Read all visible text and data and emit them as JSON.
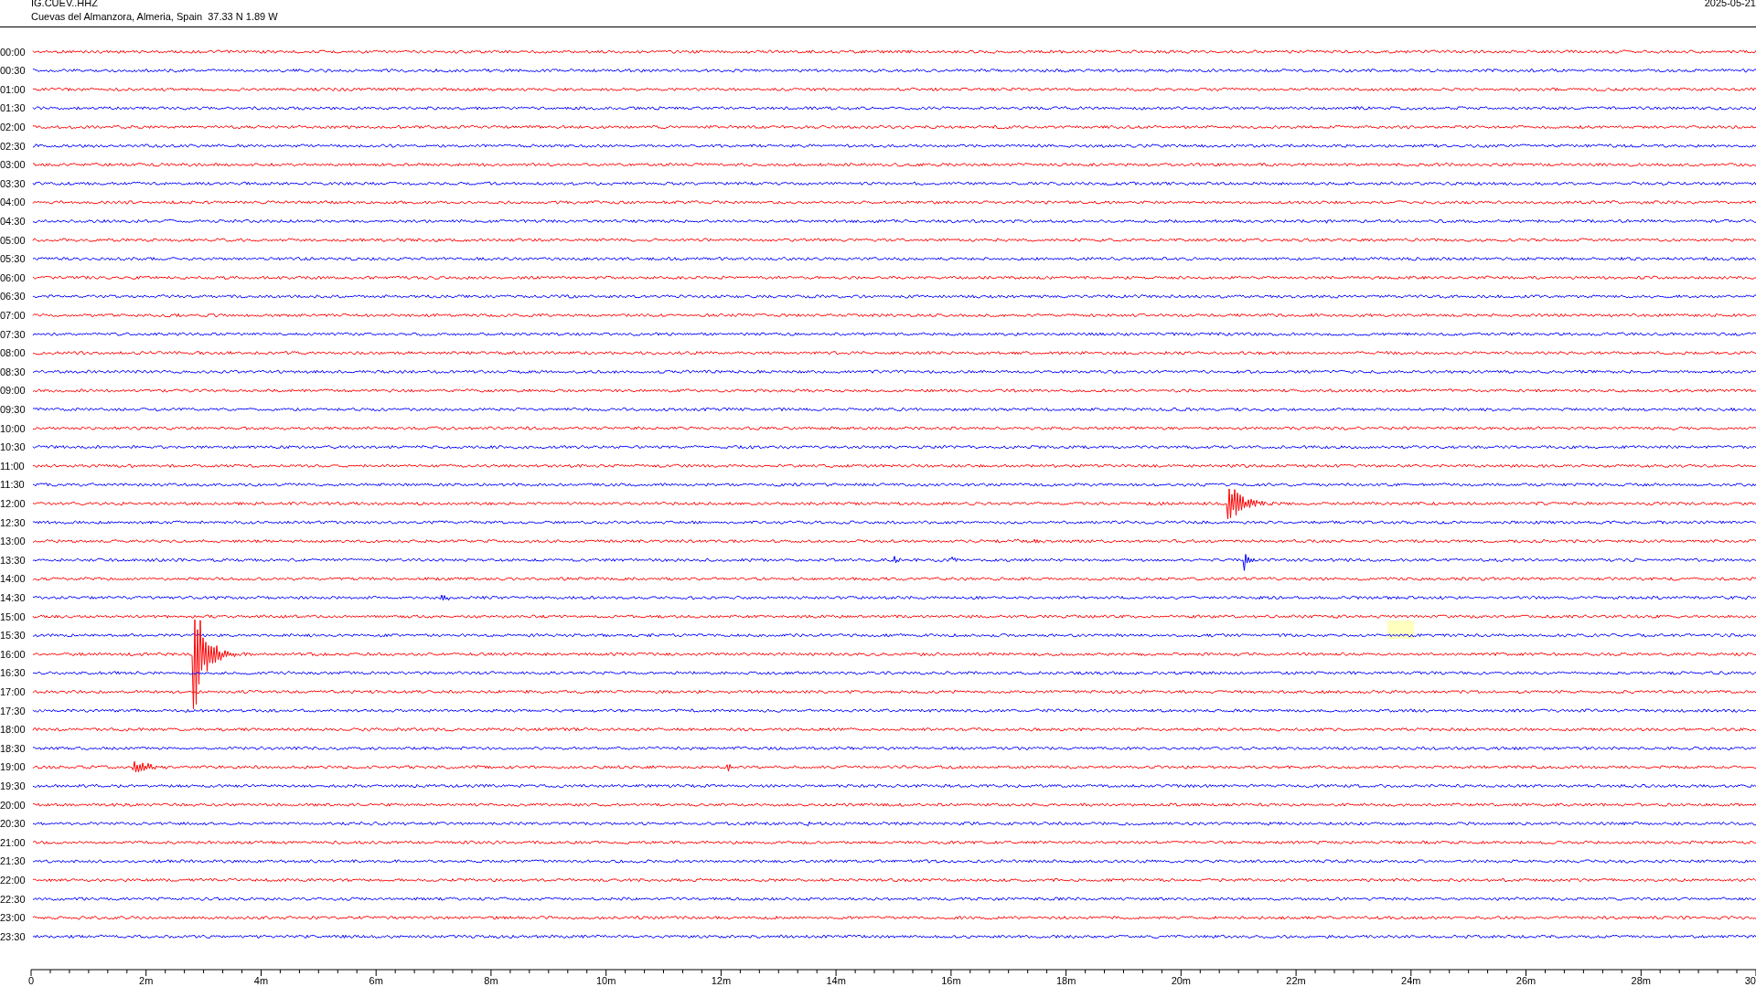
{
  "header": {
    "station": "IG.CUEV..HHZ",
    "location": "Cuevas del Almanzora, Almeria, Spain  37.33 N 1.89 W",
    "date": "2025-05-21"
  },
  "rows": [
    {
      "time": "00:00",
      "color": "#ff0000"
    },
    {
      "time": "00:30",
      "color": "#0000ff"
    },
    {
      "time": "01:00",
      "color": "#ff0000"
    },
    {
      "time": "01:30",
      "color": "#0000ff"
    },
    {
      "time": "02:00",
      "color": "#ff0000"
    },
    {
      "time": "02:30",
      "color": "#0000ff"
    },
    {
      "time": "03:00",
      "color": "#ff0000"
    },
    {
      "time": "03:30",
      "color": "#0000ff"
    },
    {
      "time": "04:00",
      "color": "#ff0000"
    },
    {
      "time": "04:30",
      "color": "#0000ff"
    },
    {
      "time": "05:00",
      "color": "#ff0000"
    },
    {
      "time": "05:30",
      "color": "#0000ff"
    },
    {
      "time": "06:00",
      "color": "#ff0000"
    },
    {
      "time": "06:30",
      "color": "#0000ff"
    },
    {
      "time": "07:00",
      "color": "#ff0000"
    },
    {
      "time": "07:30",
      "color": "#0000ff"
    },
    {
      "time": "08:00",
      "color": "#ff0000"
    },
    {
      "time": "08:30",
      "color": "#0000ff"
    },
    {
      "time": "09:00",
      "color": "#ff0000"
    },
    {
      "time": "09:30",
      "color": "#0000ff"
    },
    {
      "time": "10:00",
      "color": "#ff0000"
    },
    {
      "time": "10:30",
      "color": "#0000ff"
    },
    {
      "time": "11:00",
      "color": "#ff0000"
    },
    {
      "time": "11:30",
      "color": "#0000ff"
    },
    {
      "time": "12:00",
      "color": "#ff0000"
    },
    {
      "time": "12:30",
      "color": "#0000ff"
    },
    {
      "time": "13:00",
      "color": "#ff0000"
    },
    {
      "time": "13:30",
      "color": "#0000ff"
    },
    {
      "time": "14:00",
      "color": "#ff0000"
    },
    {
      "time": "14:30",
      "color": "#0000ff"
    },
    {
      "time": "15:00",
      "color": "#ff0000"
    },
    {
      "time": "15:30",
      "color": "#0000ff"
    },
    {
      "time": "16:00",
      "color": "#ff0000"
    },
    {
      "time": "16:30",
      "color": "#0000ff"
    },
    {
      "time": "17:00",
      "color": "#ff0000"
    },
    {
      "time": "17:30",
      "color": "#0000ff"
    },
    {
      "time": "18:00",
      "color": "#ff0000"
    },
    {
      "time": "18:30",
      "color": "#0000ff"
    },
    {
      "time": "19:00",
      "color": "#ff0000"
    },
    {
      "time": "19:30",
      "color": "#0000ff"
    },
    {
      "time": "20:00",
      "color": "#ff0000"
    },
    {
      "time": "20:30",
      "color": "#0000ff"
    },
    {
      "time": "21:00",
      "color": "#ff0000"
    },
    {
      "time": "21:30",
      "color": "#0000ff"
    },
    {
      "time": "22:00",
      "color": "#ff0000"
    },
    {
      "time": "22:30",
      "color": "#0000ff"
    },
    {
      "time": "23:00",
      "color": "#ff0000"
    },
    {
      "time": "23:30",
      "color": "#0000ff"
    }
  ],
  "time_axis": {
    "labels": [
      "0",
      "2m",
      "4m",
      "6m",
      "8m",
      "10m",
      "12m",
      "14m",
      "16m",
      "18m",
      "20m",
      "22m",
      "24m",
      "26m",
      "28m",
      "30"
    ]
  }
}
